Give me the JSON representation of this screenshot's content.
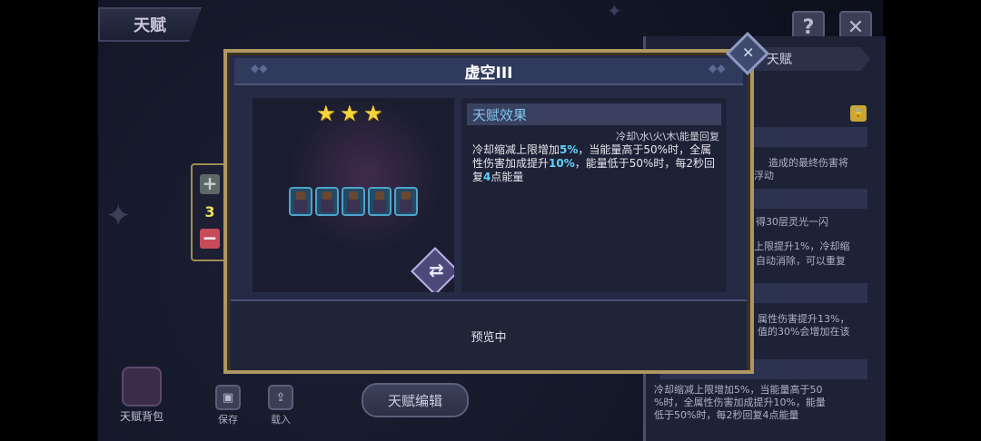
{
  "top_tab": {
    "label": "天赋"
  },
  "corner": {
    "help": "?",
    "close": "✕"
  },
  "right_panel": {
    "title": "天赋",
    "lock_glyph": "🔒",
    "lines": [
      "造成的最终伤害将",
      "浮动",
      "得30层灵光一闪",
      "上限提升1%，冷却缩",
      "自动消除，可以重复",
      "属性伤害提升13%，",
      "值的30%会增加在该",
      "冷却缩减上限增加5%，当能量高于50",
      "%时，全属性伤害加成提升10%，能量",
      "低于50%时，每2秒回复4点能量"
    ]
  },
  "stepper": {
    "plus": "+",
    "minus": "−",
    "value": "3"
  },
  "modal": {
    "title": "虚空III",
    "stars": 3,
    "preview_characters": 5,
    "effect": {
      "header": "天赋效果",
      "subtitle": "冷却\\水\\火\\木\\能量回复",
      "line1_a": "冷却缩减上限增加",
      "line1_b": "5%",
      "line1_c": "，当能量高于50%时，全属",
      "line2_a": "性伤害加成提升",
      "line2_b": "10%",
      "line2_c": "，能量低于50%时，每2秒回",
      "line3_a": "复",
      "line3_b": "4",
      "line3_c": "点能量"
    },
    "status": "预览中"
  },
  "toolbar": {
    "bag_label": "天赋背包",
    "save_label": "保存",
    "load_label": "载入",
    "edit_label": "天赋编辑"
  },
  "colors": {
    "accent_gold": "#b09762",
    "highlight_cyan": "#61d3ff",
    "star_yellow": "#f4d33c",
    "minus_red": "#c84b5a"
  }
}
